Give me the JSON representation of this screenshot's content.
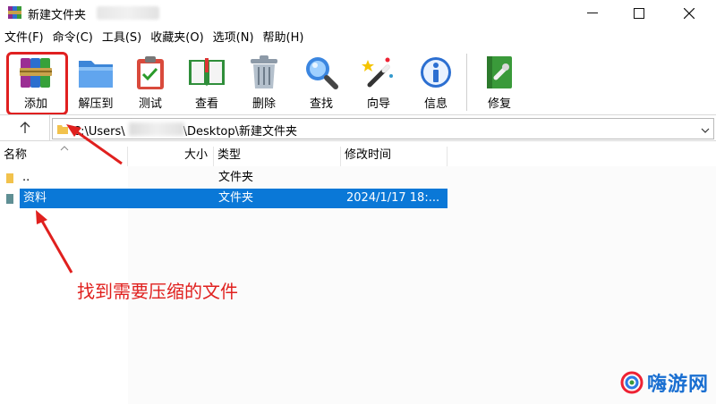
{
  "window": {
    "title": "新建文件夹",
    "controls": {
      "minimize": "minimize",
      "maximize": "maximize",
      "close": "close"
    }
  },
  "menu": [
    {
      "label": "文件(F)"
    },
    {
      "label": "命令(C)"
    },
    {
      "label": "工具(S)"
    },
    {
      "label": "收藏夹(O)"
    },
    {
      "label": "选项(N)"
    },
    {
      "label": "帮助(H)"
    }
  ],
  "toolbar": {
    "add": "添加",
    "extract": "解压到",
    "test": "测试",
    "view": "查看",
    "delete": "删除",
    "find": "查找",
    "wizard": "向导",
    "info": "信息",
    "repair": "修复"
  },
  "address": {
    "prefix": "C:\\Users\\",
    "suffix": "\\Desktop\\新建文件夹"
  },
  "columns": {
    "name": "名称",
    "size": "大小",
    "type": "类型",
    "modified": "修改时间"
  },
  "rows": [
    {
      "name": "..",
      "size": "",
      "type": "文件夹",
      "modified": ""
    },
    {
      "name": "资料",
      "size": "",
      "type": "文件夹",
      "modified": "2024/1/17 18:..."
    }
  ],
  "annotation": "找到需要压缩的文件",
  "watermark": "嗨游网",
  "colors": {
    "selection": "#0a78d7",
    "annotation": "#e0201e",
    "watermark": "#1a6fd1"
  }
}
